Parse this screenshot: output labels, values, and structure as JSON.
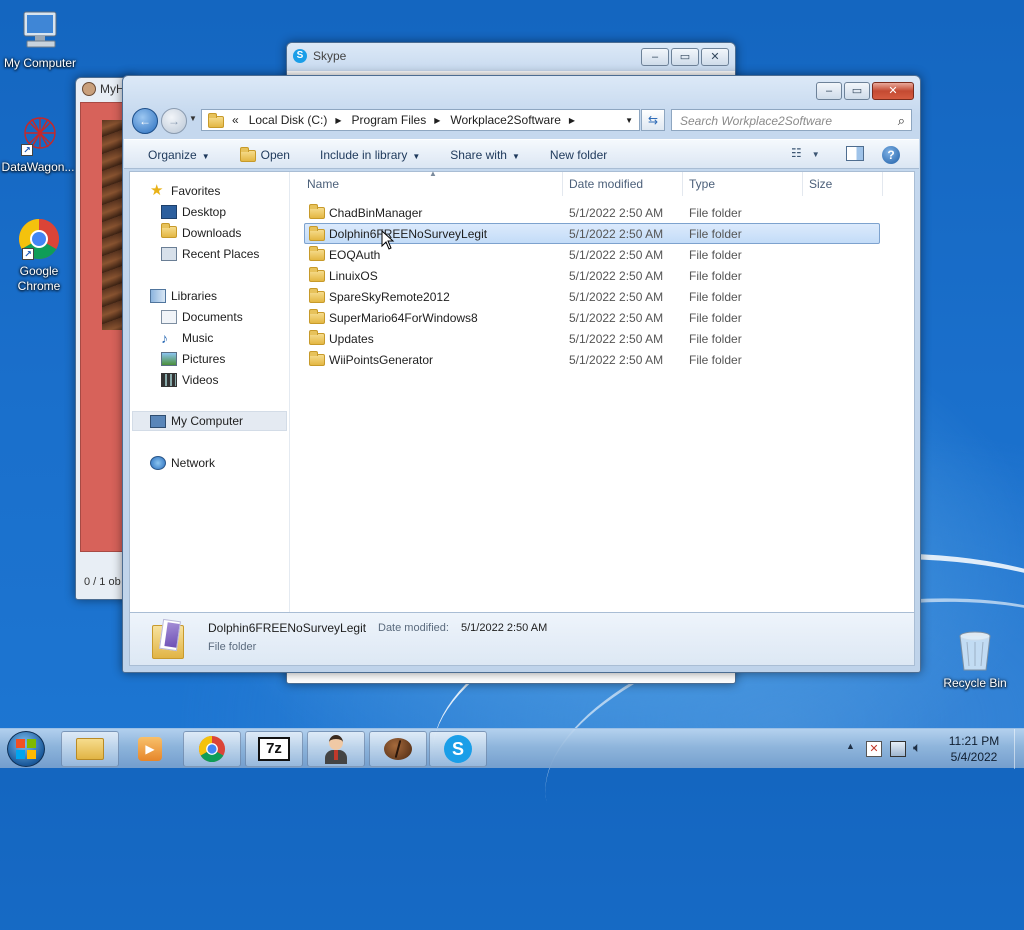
{
  "desktop": {
    "icons": [
      {
        "label": "My Computer",
        "icon": "computer-icon"
      },
      {
        "label": "DataWagon...",
        "icon": "datawagon-icon"
      },
      {
        "label": "Google Chrome",
        "icon": "chrome-icon"
      },
      {
        "label": "Recycle Bin",
        "icon": "recycle-bin-icon"
      }
    ]
  },
  "skype_window": {
    "title": "Skype"
  },
  "back_window": {
    "title": "MyH",
    "status": "0 / 1 ob"
  },
  "explorer": {
    "address": {
      "overflow": "«",
      "crumbs": [
        "Local Disk (C:)",
        "Program Files",
        "Workplace2Software"
      ]
    },
    "search_placeholder": "Search Workplace2Software",
    "commands": {
      "organize": "Organize",
      "open": "Open",
      "include": "Include in library",
      "share": "Share with",
      "new_folder": "New folder"
    },
    "nav": {
      "favorites": "Favorites",
      "desktop": "Desktop",
      "downloads": "Downloads",
      "recent": "Recent Places",
      "libraries": "Libraries",
      "documents": "Documents",
      "music": "Music",
      "pictures": "Pictures",
      "videos": "Videos",
      "computer": "My Computer",
      "network": "Network"
    },
    "columns": {
      "name": "Name",
      "date": "Date modified",
      "type": "Type",
      "size": "Size"
    },
    "files": [
      {
        "name": "ChadBinManager",
        "date": "5/1/2022 2:50 AM",
        "type": "File folder"
      },
      {
        "name": "Dolphin6FREENoSurveyLegit",
        "date": "5/1/2022 2:50 AM",
        "type": "File folder"
      },
      {
        "name": "EOQAuth",
        "date": "5/1/2022 2:50 AM",
        "type": "File folder"
      },
      {
        "name": "LinuixOS",
        "date": "5/1/2022 2:50 AM",
        "type": "File folder"
      },
      {
        "name": "SpareSkyRemote2012",
        "date": "5/1/2022 2:50 AM",
        "type": "File folder"
      },
      {
        "name": "SuperMario64ForWindows8",
        "date": "5/1/2022 2:50 AM",
        "type": "File folder"
      },
      {
        "name": "Updates",
        "date": "5/1/2022 2:50 AM",
        "type": "File folder"
      },
      {
        "name": "WiiPointsGenerator",
        "date": "5/1/2022 2:50 AM",
        "type": "File folder"
      }
    ],
    "details": {
      "name": "Dolphin6FREENoSurveyLegit",
      "modified_label": "Date modified:",
      "modified_value": "5/1/2022 2:50 AM",
      "type": "File folder"
    }
  },
  "taskbar": {
    "items": [
      "explorer-icon",
      "media-player-icon",
      "chrome-icon",
      "7zip-icon",
      "person-app-icon",
      "coffee-bean-icon",
      "skype-icon"
    ],
    "sevenzip_label": "7z",
    "clock_time": "11:21 PM",
    "clock_date": "5/4/2022"
  },
  "colors": {
    "selection": "#c3dcf8",
    "selection_border": "#7da2ce",
    "desktop": "#1a6fcb"
  }
}
